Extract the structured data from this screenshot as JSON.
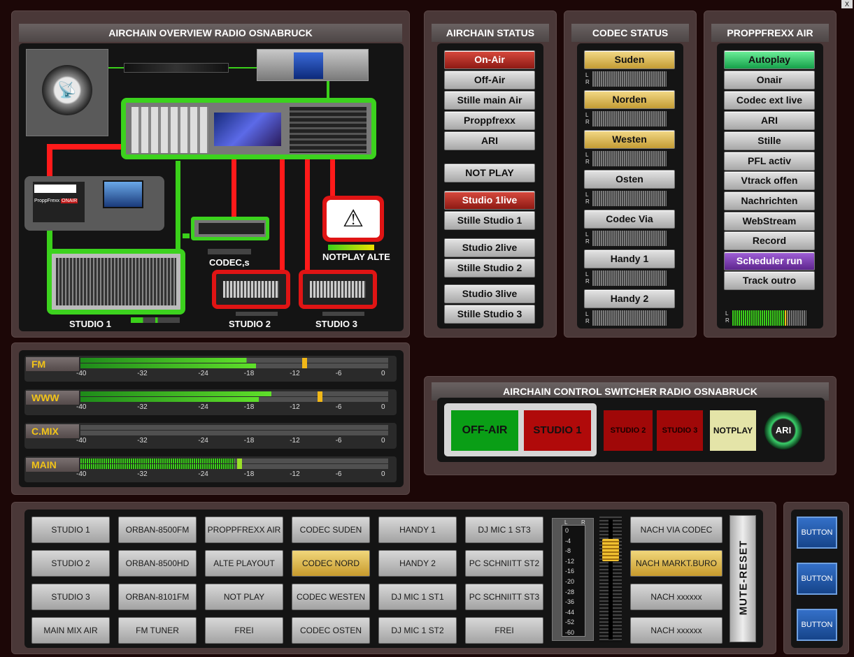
{
  "window": {
    "close_label": "X"
  },
  "overview": {
    "title": "AIRCHAIN OVERVIEW  RADIO OSNABRUCK",
    "studio1": "STUDIO 1",
    "studio2": "STUDIO 2",
    "studio3": "STUDIO 3",
    "codecs": "CODEC,s",
    "notplay": "NOTPLAY ALTE",
    "propp_brand": "ProppFrexx",
    "propp_onair": "ONAIR"
  },
  "airchain_status": {
    "title": "AIRCHAIN  STATUS",
    "buttons": [
      "On-Air",
      "Off-Air",
      "Stille main Air",
      "Proppfrexx",
      "ARI",
      "NOT PLAY",
      "Studio 1live",
      "Stille Studio 1",
      "Studio 2live",
      "Stille Studio 2",
      "Studio 3live",
      "Stille Studio 3"
    ]
  },
  "codec_status": {
    "title": "CODEC STATUS",
    "buttons": [
      "Suden",
      "Norden",
      "Westen",
      "Osten",
      "Codec Via",
      "Handy 1",
      "Handy 2"
    ],
    "l": "L",
    "r": "R"
  },
  "proppfrexx_air": {
    "title": "PROPPFREXX AIR",
    "buttons": [
      "Autoplay",
      "Onair",
      "Codec ext live",
      "ARI",
      "Stille",
      "PFL activ",
      "Vtrack offen",
      "Nachrichten",
      "WebStream",
      "Record",
      "Scheduler run",
      "Track outro"
    ],
    "l": "L",
    "r": "R"
  },
  "meters": {
    "rows": [
      {
        "label": "FM",
        "level_top": 0.54,
        "level_bottom": 0.57,
        "peak": 0.72
      },
      {
        "label": "WWW",
        "level_top": 0.62,
        "level_bottom": 0.58,
        "peak": 0.77
      },
      {
        "label": "C.MIX",
        "level_top": 0,
        "level_bottom": 0,
        "peak": 0
      },
      {
        "label": "MAIN",
        "level_top": 0.5,
        "level_bottom": 0.5,
        "peak": 0.51
      }
    ],
    "ticks": [
      "-40",
      "-32",
      "-24",
      "-18",
      "-12",
      "-6",
      "0"
    ]
  },
  "switcher": {
    "title": "AIRCHAIN CONTROL SWITCHER RADIO OSNABRUCK",
    "off_air": "OFF-AIR",
    "studio1": "STUDIO 1",
    "studio2": "STUDIO 2",
    "studio3": "STUDIO 3",
    "notplay": "NOTPLAY",
    "ari": "ARI"
  },
  "grid": {
    "columns": [
      [
        "STUDIO 1",
        "STUDIO 2",
        "STUDIO 3",
        "MAIN MIX AIR"
      ],
      [
        "ORBAN-8500FM",
        "ORBAN-8500HD",
        "ORBAN-8101FM",
        "FM TUNER"
      ],
      [
        "PROPPFREXX AIR",
        "ALTE PLAYOUT",
        "NOT PLAY",
        "FREI"
      ],
      [
        "CODEC SUDEN",
        "CODEC NORD",
        "CODEC WESTEN",
        "CODEC OSTEN"
      ],
      [
        "HANDY 1",
        "HANDY 2",
        "DJ MIC 1   ST1",
        "DJ MIC 1   ST2"
      ],
      [
        "DJ MIC 1   ST3",
        "PC SCHNIITT ST2",
        "PC SCHNIITT ST3",
        "FREI"
      ]
    ],
    "right_column": [
      "NACH VIA CODEC",
      "NACH MARKT.BURO",
      "NACH  xxxxxx",
      "NACH  xxxxxx"
    ],
    "mute_reset": "MUTE-RESET",
    "scale": [
      "0",
      "-4",
      "-8",
      "-12",
      "-16",
      "-20",
      "-28",
      "-36",
      "-44",
      "-52",
      "-60"
    ],
    "l": "L",
    "r": "R"
  },
  "side_buttons": [
    "BUTTON",
    "BUTTON",
    "BUTTON"
  ],
  "colors": {
    "active_red": "#b52a22",
    "gold": "#d8b24a",
    "green": "#22c45e",
    "purple": "#7a3aae"
  }
}
